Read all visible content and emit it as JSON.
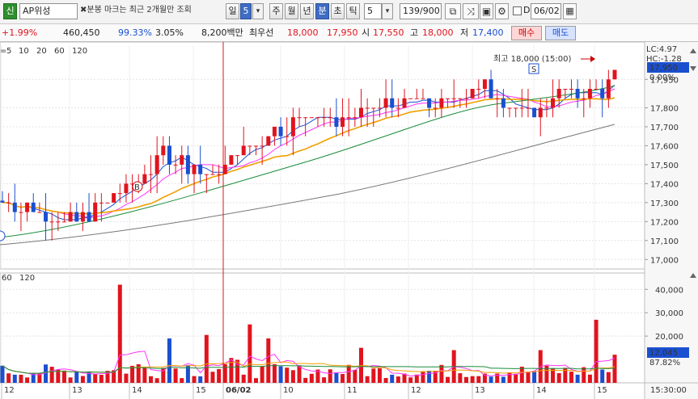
{
  "toolbar": {
    "stock_type_badge": "신",
    "stock_name": "AP위성",
    "notice": "분봉 마크는 최근 2개월만 조회",
    "period_tabs": [
      "일",
      "5",
      "주",
      "월",
      "년",
      "분",
      "초",
      "틱"
    ],
    "interval_value": "5",
    "count_display": "139/900",
    "checkbox_label": "D",
    "date_value": "06/02"
  },
  "quote": {
    "change_pct": "+1.99%",
    "volume": "460,450",
    "strength": "99.33%",
    "turnover_pct": "3.05%",
    "amount": "8,200백만",
    "priority_bid_label": "최우선",
    "priority_ask": "18,000",
    "priority_bid": "17,950",
    "open_label": "시",
    "open": "17,550",
    "high_label": "고",
    "high": "18,000",
    "low_label": "저",
    "low": "17,400",
    "buy_label": "매수",
    "sell_label": "매도"
  },
  "legend": {
    "price_ma_periods": [
      "5",
      "10",
      "20",
      "60",
      "120"
    ],
    "price_ma_colors": [
      "#1a4fd0",
      "#ff33ff",
      "#f0a000",
      "#1a8c3a",
      "#777777"
    ],
    "volume_ma_periods": [
      "60",
      "120"
    ],
    "volume_ma_colors": [
      "#1a8c3a",
      "#777777"
    ]
  },
  "annotations": {
    "max_label": "최고 18,000 (15:00)",
    "lc_label": "LC:4.97",
    "hc_label": "HC:-1.28",
    "current_price_tag": "17,950",
    "current_pct_tag": "0.00%",
    "current_volume_tag": "12,045",
    "volume_pct_tag": "87.82%",
    "mark_b": "B",
    "mark_s": "S"
  },
  "chart_data": {
    "type": "candlestick",
    "price_ylim": [
      16950,
      18130
    ],
    "price_ticks": [
      "17,950",
      "17,800",
      "17,700",
      "17,600",
      "17,500",
      "17,400",
      "17,300",
      "17,200",
      "17,100",
      "17,000"
    ],
    "volume_ylim": [
      0,
      47000
    ],
    "volume_ticks": [
      "40,000",
      "30,000",
      "20,000"
    ],
    "x_labels": [
      "12",
      "13",
      "14",
      "15",
      "06/02",
      "10",
      "11",
      "12",
      "13",
      "14",
      "15"
    ],
    "time_axis_label": "15:30:00",
    "up_color": "#e0141e",
    "down_color": "#1a4fd0"
  }
}
